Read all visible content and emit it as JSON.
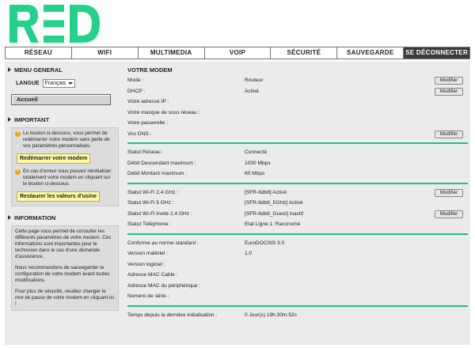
{
  "logo": {
    "text": "RED",
    "color": "#22d28b"
  },
  "nav": {
    "tabs": [
      "RÉSEAU",
      "WIFI",
      "MULTIMEDIA",
      "VOIP",
      "SÉCURITÉ",
      "SAUVEGARDE",
      "SE DÉCONNECTER"
    ],
    "active_dark": "SE DÉCONNECTER"
  },
  "sidebar": {
    "menu_title": "MENU GENERAL",
    "lang_label": "LANGUE",
    "lang_value": "Français",
    "home_button": "Accueil",
    "important_title": "IMPORTANT",
    "restart_text": "Le bouton ci-dessous, vous permet de redémarrer votre modem sans perte de vos paramètres personnalisés.",
    "restart_button": "Redémarrer votre modem",
    "reset_text": "En cas d'erreur vous pouvez réinitialiser totalement votre modem en cliquant sur le bouton ci-dessous.",
    "reset_button": "Restaurer les valeurs d'usine",
    "info_title": "INFORMATION",
    "info_p1": "Cette page vous permet de consulter les différents paramètres de votre modem. Ces informations sont importantes pour le technicien dans le cas d'une demande d'assistance.",
    "info_p2": "Nous recommandons de sauvegarder la configuration de votre modem avant toutes modifications.",
    "info_p3": "Pour plus de sécurité, veuillez changer le mot de passe de votre modem en cliquant ici !"
  },
  "main": {
    "title": "VOTRE MODEM",
    "modify_label": "Modifier",
    "groups": [
      {
        "rows": [
          {
            "label": "Mode :",
            "value": "Routeur",
            "button": true
          },
          {
            "label": "DHCP :",
            "value": "Activé",
            "button": true
          },
          {
            "label": "Votre adresse IP :",
            "value": ""
          },
          {
            "label": "Votre masque de sous réseau :",
            "value": ""
          },
          {
            "label": "Votre passerelle :",
            "value": ""
          },
          {
            "label": "Vos DNS :",
            "value": "",
            "button": true
          }
        ]
      },
      {
        "rows": [
          {
            "label": "Statut Réseau :",
            "value": "Connecté"
          },
          {
            "label": "Débit Descendant maximum :",
            "value": "1000 Mbps"
          },
          {
            "label": "Débit Montant maximum :",
            "value": "60 Mbps"
          }
        ]
      },
      {
        "rows": [
          {
            "label": "Statut Wi-Fi 2,4 GHz :",
            "value": "[SFR-6db8] Activé",
            "button": true
          },
          {
            "label": "Statut Wi-Fi 5 GHz :",
            "value": "[SFR-6db8_5GHz] Activé"
          },
          {
            "label": "Statut Wi-Fi Invité 2,4 GHz :",
            "value": "[SFR-6db8_Guest] inactif",
            "button": true
          },
          {
            "label": "Statut Téléphonie :",
            "value": "Etat Ligne 1: Raccroché"
          }
        ]
      },
      {
        "rows": [
          {
            "label": "Conforme au norme standard :",
            "value": "EuroDOCSIS 3.0"
          },
          {
            "label": "Version matériel :",
            "value": "1.0"
          },
          {
            "label": "Version logiciel :",
            "value": ""
          },
          {
            "label": "Adresse MAC Cable :",
            "value": ""
          },
          {
            "label": "Adresse MAC du périphérique :",
            "value": ""
          },
          {
            "label": "Numéro de série :",
            "value": ""
          }
        ]
      },
      {
        "rows": [
          {
            "label": "Temps depuis la dernière initialisation :",
            "value": "0 Jour(s) 19h:30m:52s"
          }
        ]
      }
    ]
  }
}
